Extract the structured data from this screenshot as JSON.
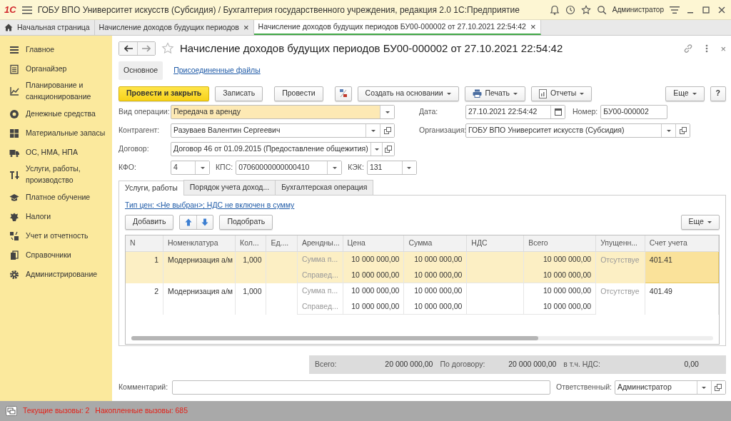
{
  "app": {
    "logo": "1С",
    "title": "ГОБУ ВПО Университет искусств (Субсидия) / Бухгалтерия государственного учреждения, редакция 2.0 1С:Предприятие",
    "user": "Администратор"
  },
  "tabs": [
    {
      "kind": "home",
      "label": "Начальная страница",
      "selected": false
    },
    {
      "kind": "doc",
      "label": "Начисление доходов будущих периодов",
      "close": "×",
      "selected": false
    },
    {
      "kind": "doc",
      "label": "Начисление доходов будущих периодов БУ00-000002 от 27.10.2021 22:54:42",
      "close": "×",
      "selected": true
    }
  ],
  "sidebar": {
    "items": [
      {
        "label": "Главное"
      },
      {
        "label": "Органайзер"
      },
      {
        "label": "Планирование и санкционирование"
      },
      {
        "label": "Денежные средства"
      },
      {
        "label": "Материальные запасы"
      },
      {
        "label": "ОС, НМА, НПА"
      },
      {
        "label": "Услуги, работы, производство"
      },
      {
        "label": "Платное обучение"
      },
      {
        "label": "Налоги"
      },
      {
        "label": "Учет и отчетность"
      },
      {
        "label": "Справочники"
      },
      {
        "label": "Администрирование"
      }
    ]
  },
  "form": {
    "title": "Начисление доходов будущих периодов БУ00-000002 от 27.10.2021 22:54:42",
    "close": "×",
    "sections": [
      {
        "label": "Основное",
        "selected": true
      },
      {
        "label": "Присоединенные файлы",
        "selected": false
      }
    ],
    "toolbar": [
      {
        "kind": "primary",
        "label": "Провести и закрыть"
      },
      {
        "kind": "plain",
        "label": "Записать"
      },
      {
        "kind": "plain",
        "label": "Провести"
      },
      {
        "kind": "dtkt"
      },
      {
        "kind": "menu",
        "label": "Создать на основании"
      },
      {
        "kind": "print",
        "label": "Печать"
      },
      {
        "kind": "report",
        "label": "Отчеты"
      },
      {
        "kind": "more",
        "label": "Еще"
      },
      {
        "kind": "help",
        "label": "?"
      }
    ],
    "fields": {
      "operation": {
        "label": "Вид операции:",
        "value": "Передача в аренду",
        "kind": "select",
        "highlighted": true
      },
      "date": {
        "label": "Дата:",
        "value": "27.10.2021 22:54:42",
        "kind": "date"
      },
      "number": {
        "label": "Номер:",
        "value": "БУ00-000002"
      },
      "counterparty": {
        "label": "Контрагент:",
        "value": "Разуваев Валентин Сергеевич",
        "kind": "select_open"
      },
      "organization": {
        "label": "Организация:",
        "value": "ГОБУ ВПО Университет искусств (Субсидия)",
        "kind": "select_open"
      },
      "contract": {
        "label": "Договор:",
        "value": "Договор 46 от 01.09.2015 (Предоставление общежития)",
        "kind": "select_open"
      },
      "kfo": {
        "label": "КФО:",
        "value": "4",
        "kind": "select"
      },
      "kps": {
        "label": "КПС:",
        "value": "07060000000000410",
        "kind": "select"
      },
      "kek": {
        "label": "КЭК:",
        "value": "131",
        "kind": "select"
      }
    },
    "inner_tabs": [
      {
        "label": "Услуги, работы",
        "selected": true
      },
      {
        "label": "Порядок учета доход...",
        "selected": false
      },
      {
        "label": "Бухгалтерская операция",
        "selected": false
      }
    ],
    "price_link": "Тип цен: <Не выбран>; НДС не включен в сумму",
    "table_buttons": {
      "add": "Добавить",
      "pick": "Подобрать",
      "more": "Еще"
    },
    "table": {
      "columns": [
        "N",
        "Номенклатура",
        "Кол...",
        "Ед....",
        "Арендны...",
        "Цена",
        "Сумма",
        "НДС",
        "Всего",
        "Упущенн...",
        "Счет учета"
      ],
      "rows": [
        {
          "n": "1",
          "item": "Модернизация а/м",
          "qty": "1,000",
          "lost": "Отсутствуе",
          "account": "401.41",
          "selected": true,
          "lines": [
            {
              "lease": "Сумма п...",
              "price": "10 000 000,00",
              "sum": "10 000 000,00",
              "total": "10 000 000,00"
            },
            {
              "lease": "Справед...",
              "price": "10 000 000,00",
              "sum": "10 000 000,00",
              "total": "10 000 000,00"
            }
          ]
        },
        {
          "n": "2",
          "item": "Модернизация а/м",
          "qty": "1,000",
          "lost": "Отсутствуе",
          "account": "401.49",
          "selected": false,
          "lines": [
            {
              "lease": "Сумма п...",
              "price": "10 000 000,00",
              "sum": "10 000 000,00",
              "total": "10 000 000,00"
            },
            {
              "lease": "Справед...",
              "price": "10 000 000,00",
              "sum": "10 000 000,00",
              "total": "10 000 000,00"
            }
          ]
        }
      ]
    },
    "totals": [
      {
        "label": "Всего:",
        "value": "20 000 000,00"
      },
      {
        "label": "По договору:",
        "value": "20 000 000,00"
      },
      {
        "label": "в т.ч. НДС:",
        "value": "0,00"
      }
    ],
    "comment": {
      "label": "Комментарий:"
    },
    "responsible": {
      "label": "Ответственный:",
      "value": "Администратор"
    }
  },
  "status_bar": {
    "current": "Текущие вызовы: 2",
    "accumulated": "Накопленные вызовы: 685"
  }
}
